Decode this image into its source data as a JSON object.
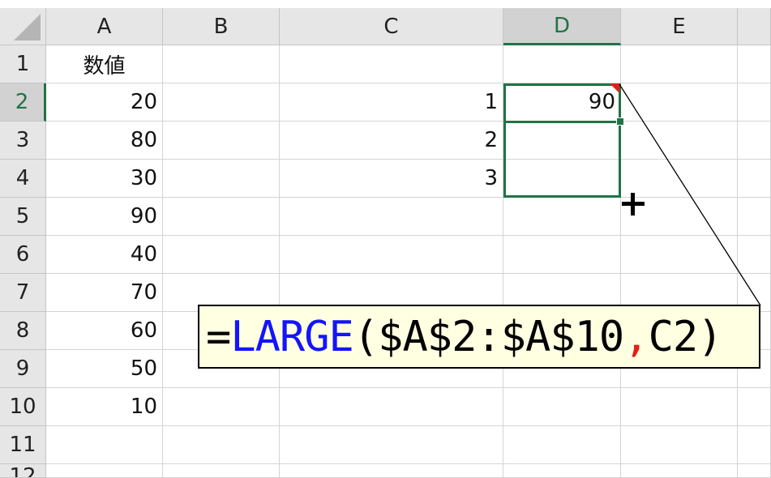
{
  "columns": [
    "A",
    "B",
    "C",
    "D",
    "E"
  ],
  "rows": [
    "1",
    "2",
    "3",
    "4",
    "5",
    "6",
    "7",
    "8",
    "9",
    "10",
    "11",
    "12"
  ],
  "cells": {
    "A1": "数値",
    "A2": "20",
    "A3": "80",
    "A4": "30",
    "A5": "90",
    "A6": "40",
    "A7": "70",
    "A8": "60",
    "A9": "50",
    "A10": "10",
    "C2": "1",
    "C3": "2",
    "C4": "3",
    "D2": "90"
  },
  "formula_callout": {
    "equals": "=",
    "function": "LARGE",
    "open": "(",
    "range": "$A$2:$A$10",
    "comma": ",",
    "arg2": " C2",
    "close": ")"
  },
  "colors": {
    "grid_selection": "#217346",
    "function_color": "#1414ff",
    "comma_color": "#e0201a",
    "callout_bg": "#ffffe1"
  }
}
